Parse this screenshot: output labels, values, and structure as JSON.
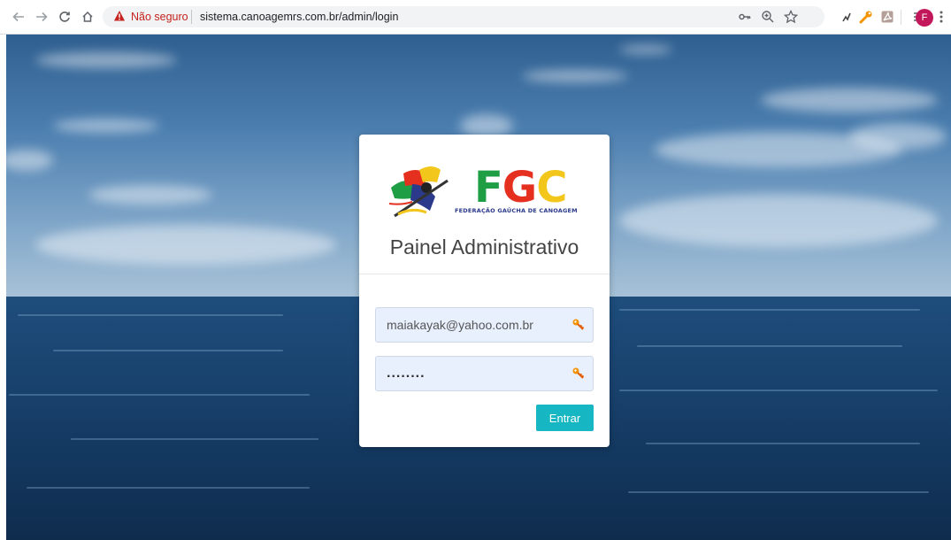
{
  "browser": {
    "security_label": "Não seguro",
    "url": "sistema.canoagemrs.com.br/admin/login",
    "profile_initial": "F",
    "icons": [
      "back-icon",
      "forward-icon",
      "reload-icon",
      "home-icon",
      "warning-icon",
      "key-icon",
      "zoom-icon",
      "star-icon",
      "extension-icon",
      "wrench-icon",
      "pdf-icon",
      "reading-list-icon",
      "avatar",
      "menu-icon"
    ]
  },
  "login": {
    "logo_text": "FGC",
    "logo_subtitle": "FEDERAÇÃO GAÚCHA DE CANOAGEM",
    "title": "Painel Administrativo",
    "email_value": "maiakayak@yahoo.com.br",
    "password_value": "........",
    "submit_label": "Entrar"
  },
  "colors": {
    "accent": "#17b6c3",
    "warning": "#c5221f",
    "logo_green": "#1f9e45",
    "logo_red": "#e53020",
    "logo_yellow": "#f3c61b",
    "logo_blue": "#2b3a8a"
  }
}
